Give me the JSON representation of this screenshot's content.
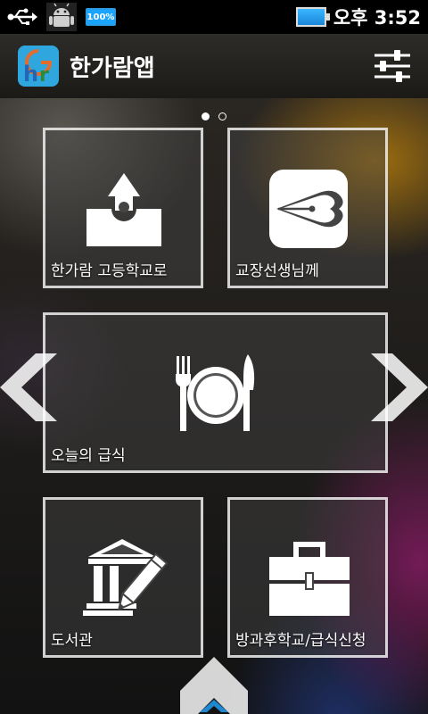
{
  "status_bar": {
    "battery_badge": "100%",
    "time": "오후 3:52",
    "icons": [
      "usb-icon",
      "android-debug-icon",
      "battery-small-icon",
      "battery-icon"
    ]
  },
  "app_bar": {
    "title": "한가람앱",
    "logo_icon": "app-logo-icon",
    "settings_icon": "sliders-icon"
  },
  "pager": {
    "page_count": 2,
    "current_page": 1
  },
  "tiles": {
    "school": {
      "label": "한가람 고등학교로",
      "icon": "school-building-icon"
    },
    "principal": {
      "label": "교장선생님께",
      "icon": "fountain-pen-icon"
    },
    "meal": {
      "label": "오늘의 급식",
      "icon": "fork-plate-knife-icon"
    },
    "library": {
      "label": "도서관",
      "icon": "library-pencil-icon"
    },
    "afterschool": {
      "label": "방과후학교/급식신청",
      "icon": "briefcase-icon"
    }
  },
  "navigation": {
    "prev_icon": "chevron-left-icon",
    "next_icon": "chevron-right-icon",
    "drawer_icon": "chevron-up-icon"
  },
  "colors": {
    "accent_blue": "#2fa7de",
    "tile_border": "#ffffff",
    "app_bar": "#23221e"
  }
}
